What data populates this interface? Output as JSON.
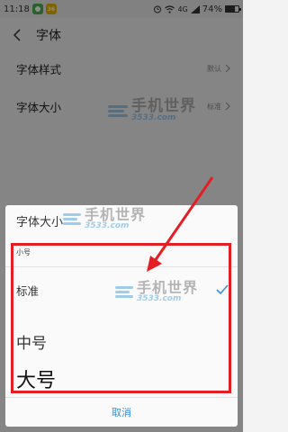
{
  "status_bar": {
    "time": "11:18",
    "app_badge_label": "36",
    "network": "4G",
    "battery": "74%",
    "battery_level": 0.74
  },
  "header": {
    "title": "字体"
  },
  "settings": {
    "items": [
      {
        "label": "字体样式",
        "value": "默认"
      },
      {
        "label": "字体大小",
        "value": "标准"
      }
    ]
  },
  "dialog": {
    "title": "字体大小",
    "options": [
      {
        "label": "小号",
        "selected": false
      },
      {
        "label": "标准",
        "selected": true
      },
      {
        "label": "中号",
        "selected": false
      },
      {
        "label": "大号",
        "selected": false
      }
    ],
    "cancel_label": "取消"
  },
  "watermark": {
    "brand": "手机世界",
    "domain": "3533.com"
  },
  "colors": {
    "annotation": "#e31e24",
    "accent": "#3a8fd9"
  }
}
